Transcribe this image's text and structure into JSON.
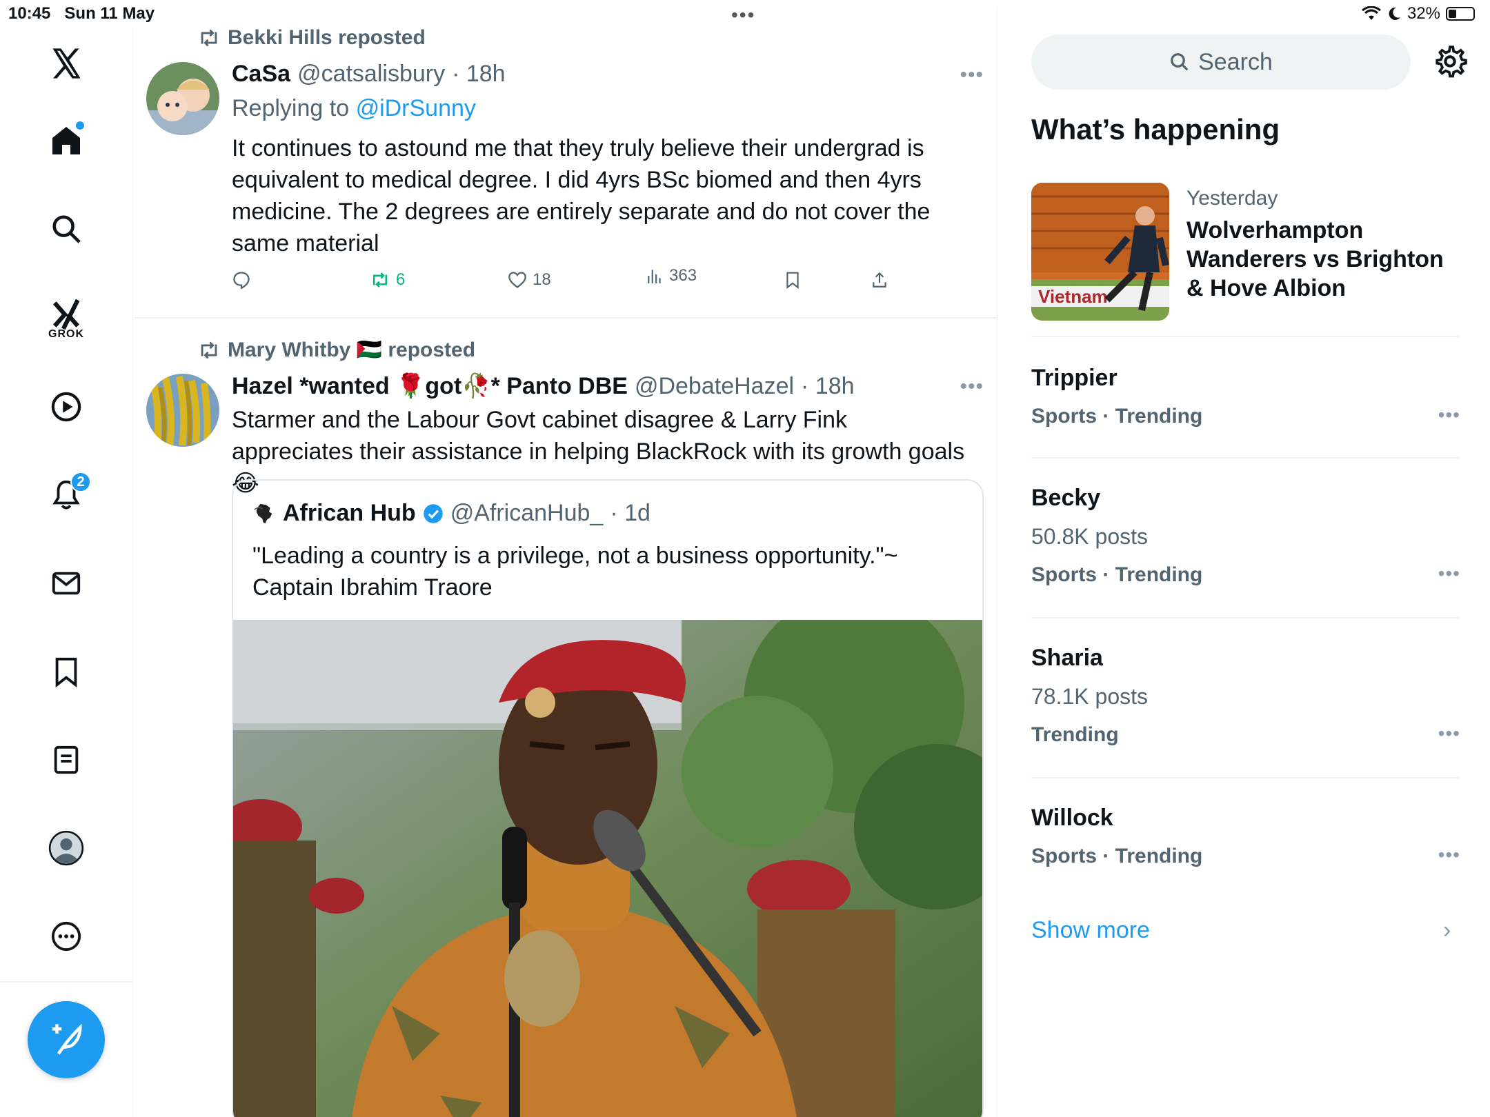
{
  "status": {
    "time": "10:45",
    "date": "Sun 11 May",
    "battery": "32%"
  },
  "nav": {
    "grok_label": "GROK",
    "notifications_badge": "2",
    "items": [
      "x-logo",
      "home",
      "search",
      "grok",
      "videos",
      "notifications",
      "messages",
      "bookmarks",
      "lists",
      "profile",
      "more"
    ]
  },
  "feed": {
    "posts": [
      {
        "reposted_by": "Bekki Hills reposted",
        "display_name": "CaSa",
        "handle": "@catsalisbury",
        "time": "· 18h",
        "replying_label": "Replying to",
        "replying_to": "@iDrSunny",
        "text": "It continues to astound me that they truly believe their undergrad is equivalent to medical degree. I did 4yrs BSc biomed and then 4yrs medicine. The 2 degrees are entirely separate and do not cover the same material",
        "reposts": "6",
        "likes": "18",
        "views": "363"
      },
      {
        "reposted_by": "Mary Whitby 🇵🇸 reposted",
        "display_name": "Hazel *wanted 🌹got🥀* Panto DBE",
        "handle": "@DebateHazel",
        "time": "· 18h",
        "text": "Starmer and the Labour Govt cabinet disagree & Larry Fink appreciates their assistance in helping BlackRock with its growth goals 😂",
        "quote": {
          "display_name": "African Hub",
          "handle": "@AfricanHub_",
          "time": "· 1d",
          "text": "\"Leading a country is a privilege, not a business opportunity.\"~ Captain Ibrahim Traore"
        }
      }
    ]
  },
  "sidebar": {
    "search_placeholder": "Search",
    "title": "What’s happening",
    "featured": {
      "when": "Yesterday",
      "title": "Wolverhampton Wanderers vs Brighton & Hove Albion",
      "thumb_text": "Vietnam"
    },
    "trends": [
      {
        "name": "Trippier",
        "posts": "",
        "category": "Sports · Trending"
      },
      {
        "name": "Becky",
        "posts": "50.8K posts",
        "category": "Sports · Trending"
      },
      {
        "name": "Sharia",
        "posts": "78.1K posts",
        "category": "Trending"
      },
      {
        "name": "Willock",
        "posts": "",
        "category": "Sports · Trending"
      }
    ],
    "show_more": "Show more"
  },
  "colors": {
    "accent": "#1d9bf0",
    "repost_green": "#00ba7c",
    "muted": "#536471"
  }
}
